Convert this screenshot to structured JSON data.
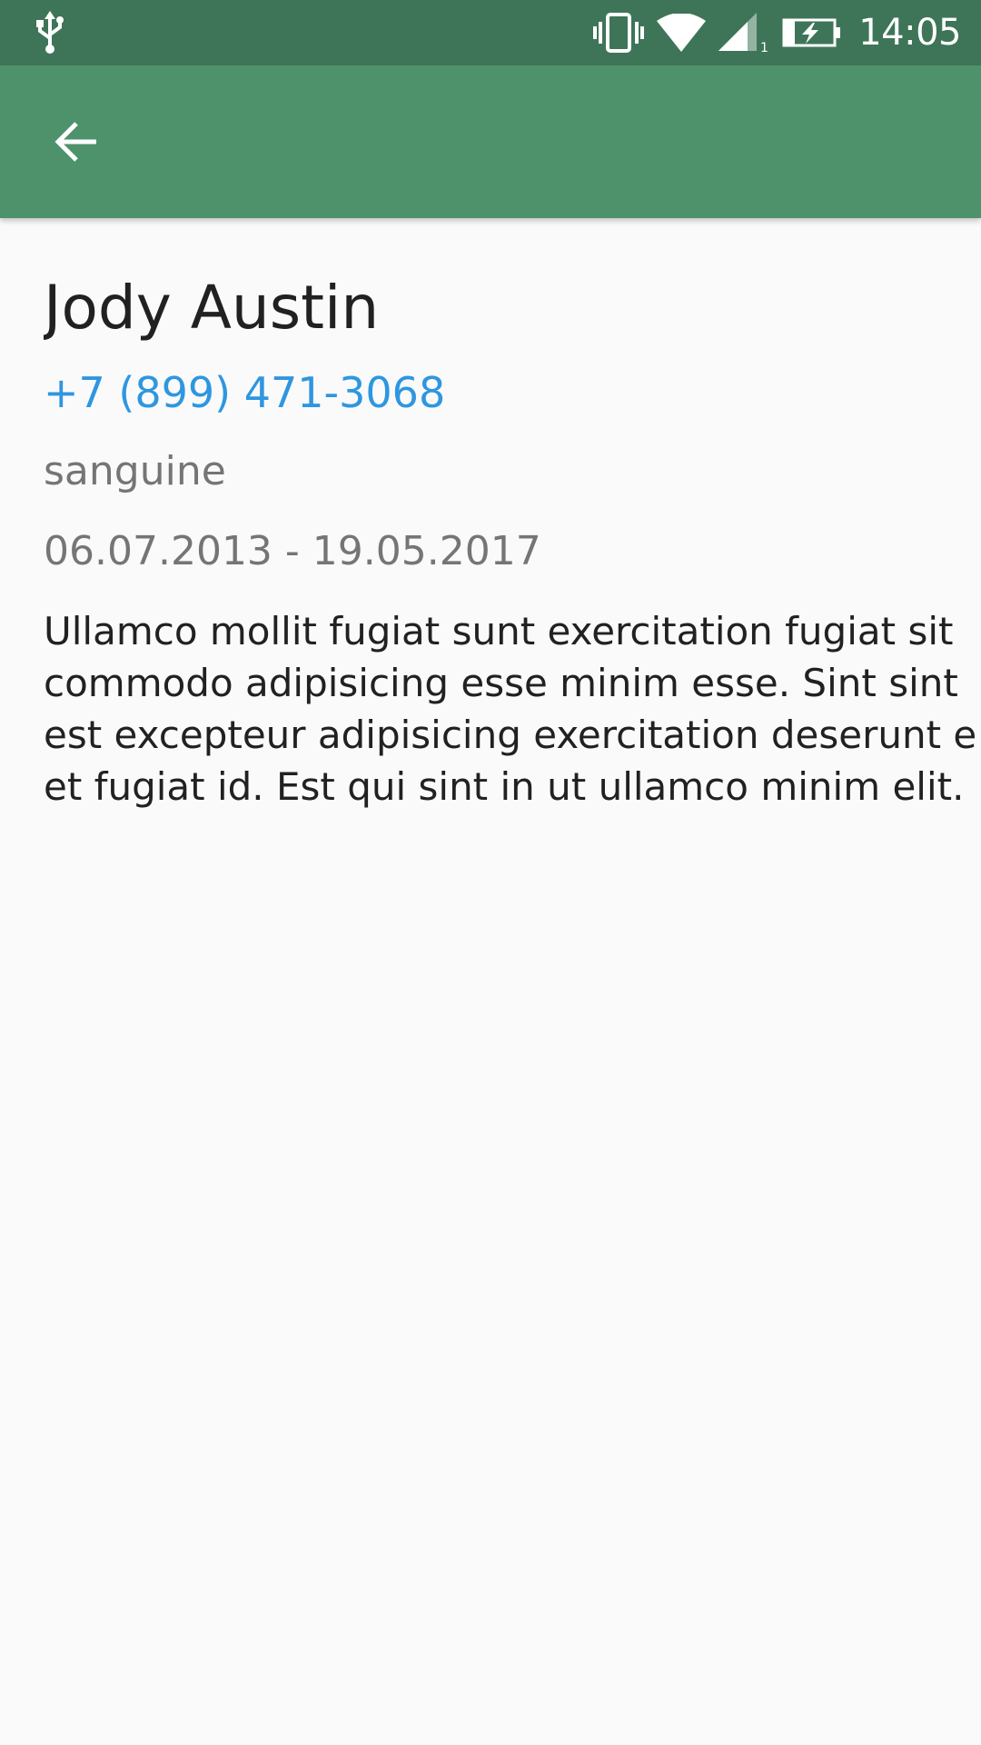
{
  "status_bar": {
    "time": "14:05",
    "icons": [
      "usb-icon",
      "vibrate-icon",
      "wifi-icon",
      "signal-icon",
      "battery-charging-icon"
    ],
    "signal_sim_label": "1"
  },
  "app_bar": {
    "back_icon": "arrow-back-icon",
    "color": "#4e926b"
  },
  "colors": {
    "status_bar": "#3e7558",
    "app_bar": "#4e926b",
    "phone_link": "#2f96e0",
    "secondary_text": "#757575",
    "primary_text": "#212121",
    "background": "#fafafa"
  },
  "contact": {
    "name": "Jody Austin",
    "phone": "+7 (899) 471-3068",
    "temperament": "sanguine",
    "education_period": "06.07.2013 - 19.05.2017",
    "biography_lines": [
      "Ullamco mollit fugiat sunt exercitation fugiat sit",
      "commodo adipisicing esse minim esse. Sint sint",
      "est excepteur adipisicing exercitation deserunt e",
      "et fugiat id. Est qui sint in ut ullamco minim elit."
    ]
  }
}
